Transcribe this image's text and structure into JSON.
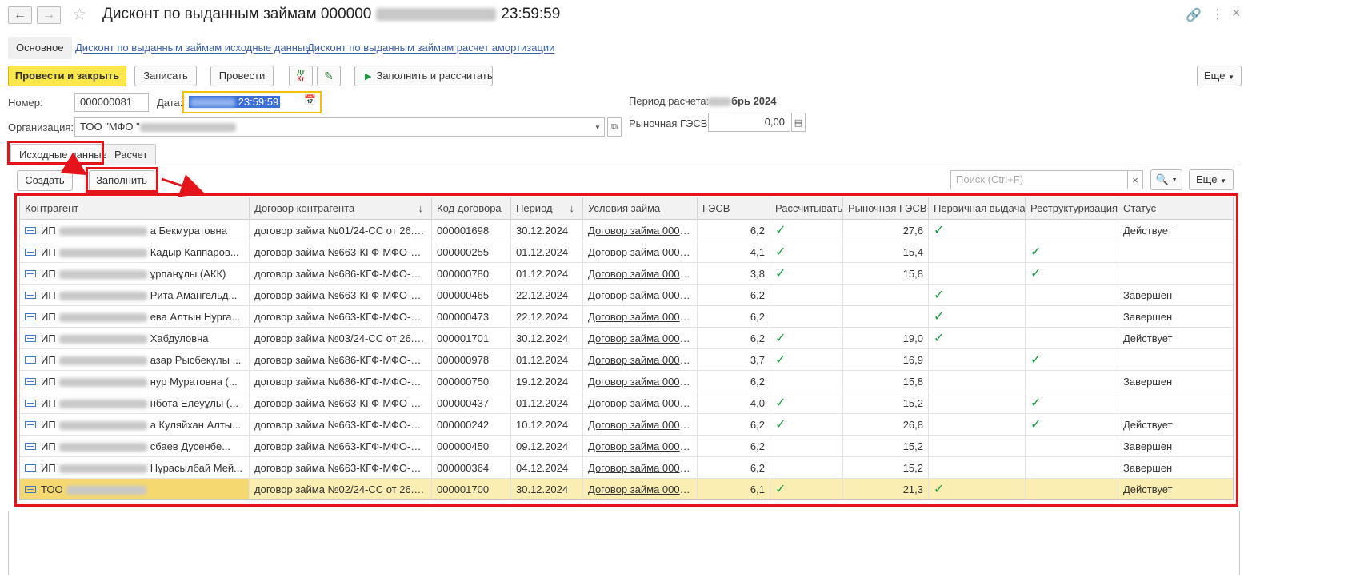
{
  "window": {
    "title": "Дисконт по выданным займам 000000",
    "title_time": "23:59:59"
  },
  "sections": {
    "main": "Основное",
    "link1": "Дисконт по выданным займам исходные данные",
    "link2": "Дисконт по выданным займам расчет амортизации"
  },
  "toolbar": {
    "post_close": "Провести и закрыть",
    "save": "Записать",
    "post": "Провести",
    "dt_kt": "Дт Кт",
    "fill_calc": "Заполнить и рассчитать",
    "more": "Еще"
  },
  "form": {
    "number_label": "Номер:",
    "number_value": "000000081",
    "date_label": "Дата:",
    "date_value": "23:59:59",
    "org_label": "Организация:",
    "org_value": "ТОО \"МФО \"",
    "period_label": "Период расчета:",
    "period_value": "брь 2024",
    "market_label": "Рыночная ГЭСВ:",
    "market_value": "0,00"
  },
  "tabs": {
    "source": "Исходные данные",
    "calc": "Расчет"
  },
  "table_toolbar": {
    "create": "Создать",
    "fill": "Заполнить",
    "search_placeholder": "Поиск (Ctrl+F)",
    "close_x": "×",
    "more": "Еще"
  },
  "table": {
    "headers": [
      "Контрагент",
      "Договор контрагента",
      "Код договора",
      "Период",
      "Условия займа",
      "ГЭСВ",
      "Рассчитывать",
      "Рыночная ГЭСВ",
      "Первичная выдача",
      "Реструктуризация",
      "Статус"
    ],
    "rows": [
      {
        "prefix": "ИП",
        "name": "а Бекмуратовна",
        "contract": "договор займа №01/24-СС от 26.12....",
        "code": "000001698",
        "period": "30.12.2024",
        "terms": "Договор займа 0000...",
        "gesv": "6,2",
        "calc": true,
        "market": "27,6",
        "primary": true,
        "restr": false,
        "status": "Действует"
      },
      {
        "prefix": "ИП",
        "name": "Кадыр Каппаров...",
        "contract": "договор займа №663-КГФ-МФО-ДК...",
        "code": "000000255",
        "period": "01.12.2024",
        "terms": "Договор займа 0000...",
        "gesv": "4,1",
        "calc": true,
        "market": "15,4",
        "primary": false,
        "restr": true,
        "status": ""
      },
      {
        "prefix": "ИП",
        "name": "ұрпанұлы (АКК)",
        "contract": "договор займа №686-КГФ-МФО-ДК...",
        "code": "000000780",
        "period": "01.12.2024",
        "terms": "Договор займа 0000...",
        "gesv": "3,8",
        "calc": true,
        "market": "15,8",
        "primary": false,
        "restr": true,
        "status": ""
      },
      {
        "prefix": "ИП",
        "name": "Рита Амангельд...",
        "contract": "договор займа №663-КГФ-МФО-ДК...",
        "code": "000000465",
        "period": "22.12.2024",
        "terms": "Договор займа 0000...",
        "gesv": "6,2",
        "calc": false,
        "market": "",
        "primary": true,
        "restr": false,
        "status": "Завершен"
      },
      {
        "prefix": "ИП",
        "name": "ева Алтын Нурга...",
        "contract": "договор займа №663-КГФ-МФО-ДК...",
        "code": "000000473",
        "period": "22.12.2024",
        "terms": "Договор займа 0000...",
        "gesv": "6,2",
        "calc": false,
        "market": "",
        "primary": true,
        "restr": false,
        "status": "Завершен"
      },
      {
        "prefix": "ИП",
        "name": "Хабдуловна",
        "contract": "договор займа №03/24-СС от 26.12....",
        "code": "000001701",
        "period": "30.12.2024",
        "terms": "Договор займа 0000...",
        "gesv": "6,2",
        "calc": true,
        "market": "19,0",
        "primary": true,
        "restr": false,
        "status": "Действует"
      },
      {
        "prefix": "ИП",
        "name": "азар Рысбекұлы ...",
        "contract": "договор займа №686-КГФ-МФО-ДК...",
        "code": "000000978",
        "period": "01.12.2024",
        "terms": "Договор займа 0000...",
        "gesv": "3,7",
        "calc": true,
        "market": "16,9",
        "primary": false,
        "restr": true,
        "status": ""
      },
      {
        "prefix": "ИП",
        "name": "нур Муратовна (...",
        "contract": "договор займа №686-КГФ-МФО-ДК...",
        "code": "000000750",
        "period": "19.12.2024",
        "terms": "Договор займа 0000...",
        "gesv": "6,2",
        "calc": false,
        "market": "15,8",
        "primary": false,
        "restr": false,
        "status": "Завершен"
      },
      {
        "prefix": "ИП",
        "name": "нбота Елеуұлы (...",
        "contract": "договор займа №663-КГФ-МФО-ДК...",
        "code": "000000437",
        "period": "01.12.2024",
        "terms": "Договор займа 0000...",
        "gesv": "4,0",
        "calc": true,
        "market": "15,2",
        "primary": false,
        "restr": true,
        "status": ""
      },
      {
        "prefix": "ИП",
        "name": "а Куляйхан Алты...",
        "contract": "договор займа №663-КГФ-МФО-ДК...",
        "code": "000000242",
        "period": "10.12.2024",
        "terms": "Договор займа 0000...",
        "gesv": "6,2",
        "calc": true,
        "market": "26,8",
        "primary": false,
        "restr": true,
        "status": "Действует"
      },
      {
        "prefix": "ИП",
        "name": "сбаев Дусенбе...",
        "contract": "договор займа №663-КГФ-МФО-ДК...",
        "code": "000000450",
        "period": "09.12.2024",
        "terms": "Договор займа 0000...",
        "gesv": "6,2",
        "calc": false,
        "market": "15,2",
        "primary": false,
        "restr": false,
        "status": "Завершен"
      },
      {
        "prefix": "ИП",
        "name": "Нұрасылбай Мей...",
        "contract": "договор займа №663-КГФ-МФО-ДК...",
        "code": "000000364",
        "period": "04.12.2024",
        "terms": "Договор займа 0000...",
        "gesv": "6,2",
        "calc": false,
        "market": "15,2",
        "primary": false,
        "restr": false,
        "status": "Завершен"
      },
      {
        "prefix": "ТОО",
        "name": "",
        "contract": "договор займа №02/24-СС от 26.12....",
        "code": "000001700",
        "period": "30.12.2024",
        "terms": "Договор займа 0000...",
        "gesv": "6,1",
        "calc": true,
        "market": "21,3",
        "primary": true,
        "restr": false,
        "status": "Действует"
      }
    ]
  },
  "colors": {
    "accent_yellow": "#fde74a",
    "highlight_red": "#e4141a",
    "check_green": "#1a9a40",
    "selected_row": "#fbeeb3"
  }
}
